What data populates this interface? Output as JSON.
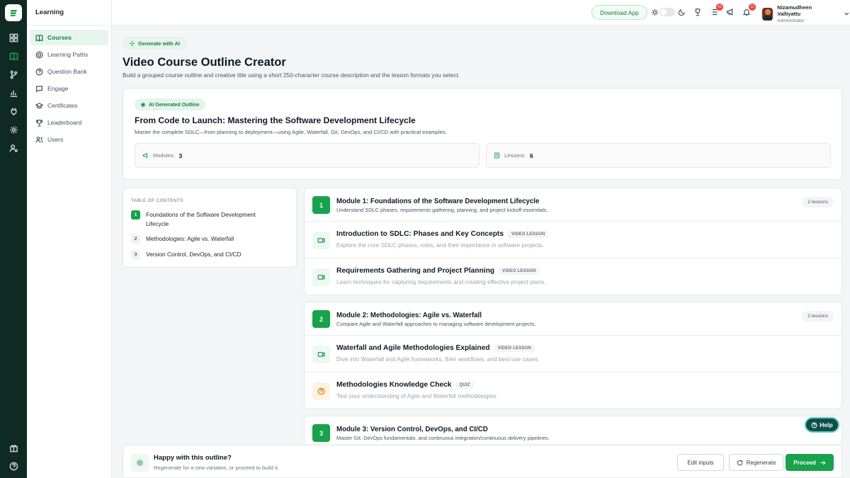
{
  "sidebar": {
    "section_title": "Learning",
    "items": [
      {
        "label": "Courses",
        "icon": "book-icon",
        "active": true
      },
      {
        "label": "Learning Paths",
        "icon": "path-icon"
      },
      {
        "label": "Question Bank",
        "icon": "question-icon"
      },
      {
        "label": "Engage",
        "icon": "chat-icon"
      },
      {
        "label": "Certificates",
        "icon": "certificate-icon"
      },
      {
        "label": "Leaderboard",
        "icon": "trophy-icon"
      },
      {
        "label": "Users",
        "icon": "users-icon"
      }
    ]
  },
  "topbar": {
    "download_label": "Download App",
    "list_badge": "10",
    "notify_badge": "11",
    "user_name": "Nizamudheen Valliyattu",
    "user_role": "Administrator"
  },
  "page": {
    "generate_label": "Generate with AI",
    "title": "Video Course Outline Creator",
    "subtitle": "Build a grouped course outline and creative title using a short 250-character course description and the lesson formats you select."
  },
  "outline": {
    "badge": "AI Generated Outline",
    "title": "From Code to Launch: Mastering the Software Development Lifecycle",
    "description": "Master the complete SDLC—from planning to deployment—using Agile, Waterfall, Git, DevOps, and CI/CD with practical examples.",
    "modules_label": "Modules:",
    "modules_value": "3",
    "lessons_label": "Lessons:",
    "lessons_value": "6"
  },
  "toc": {
    "heading": "TABLE OF CONTENTS",
    "items": [
      {
        "num": "1",
        "label": "Foundations of the Software Development Lifecycle"
      },
      {
        "num": "2",
        "label": "Methodologies: Agile vs. Waterfall"
      },
      {
        "num": "3",
        "label": "Version Control, DevOps, and CI/CD"
      }
    ]
  },
  "modules": [
    {
      "num": "1",
      "title": "Module 1: Foundations of the Software Development Lifecycle",
      "subtitle": "Understand SDLC phases, requirements gathering, planning, and project kickoff essentials.",
      "count": "2 lessons",
      "lessons": [
        {
          "title": "Introduction to SDLC: Phases and Key Concepts",
          "tag": "VIDEO LESSON",
          "desc": "Explore the core SDLC phases, roles, and their importance in software projects."
        },
        {
          "title": "Requirements Gathering and Project Planning",
          "tag": "VIDEO LESSON",
          "desc": "Learn techniques for capturing requirements and creating effective project plans."
        }
      ]
    },
    {
      "num": "2",
      "title": "Module 2: Methodologies: Agile vs. Waterfall",
      "subtitle": "Compare Agile and Waterfall approaches to managing software development projects.",
      "count": "2 lessons",
      "lessons": [
        {
          "title": "Waterfall and Agile Methodologies Explained",
          "tag": "VIDEO LESSON",
          "desc": "Dive into Waterfall and Agile frameworks, their workflows, and best use cases."
        },
        {
          "title": "Methodologies Knowledge Check",
          "tag": "QUIZ",
          "desc": "Test your understanding of Agile and Waterfall methodologies."
        }
      ]
    },
    {
      "num": "3",
      "title": "Module 3: Version Control, DevOps, and CI/CD",
      "subtitle": "Master Git, DevOps fundamentals, and continuous integration/continuous delivery pipelines."
    }
  ],
  "help_label": "Help",
  "footer": {
    "title": "Happy with this outline?",
    "subtitle": "Regenerate for a new variation, or proceed to build it.",
    "edit_label": "Edit inputs",
    "regen_label": "Regenerate",
    "proceed_label": "Proceed"
  },
  "colors": {
    "accent": "#16a34a",
    "rail": "#0f2a22",
    "badge": "#ef4444"
  }
}
